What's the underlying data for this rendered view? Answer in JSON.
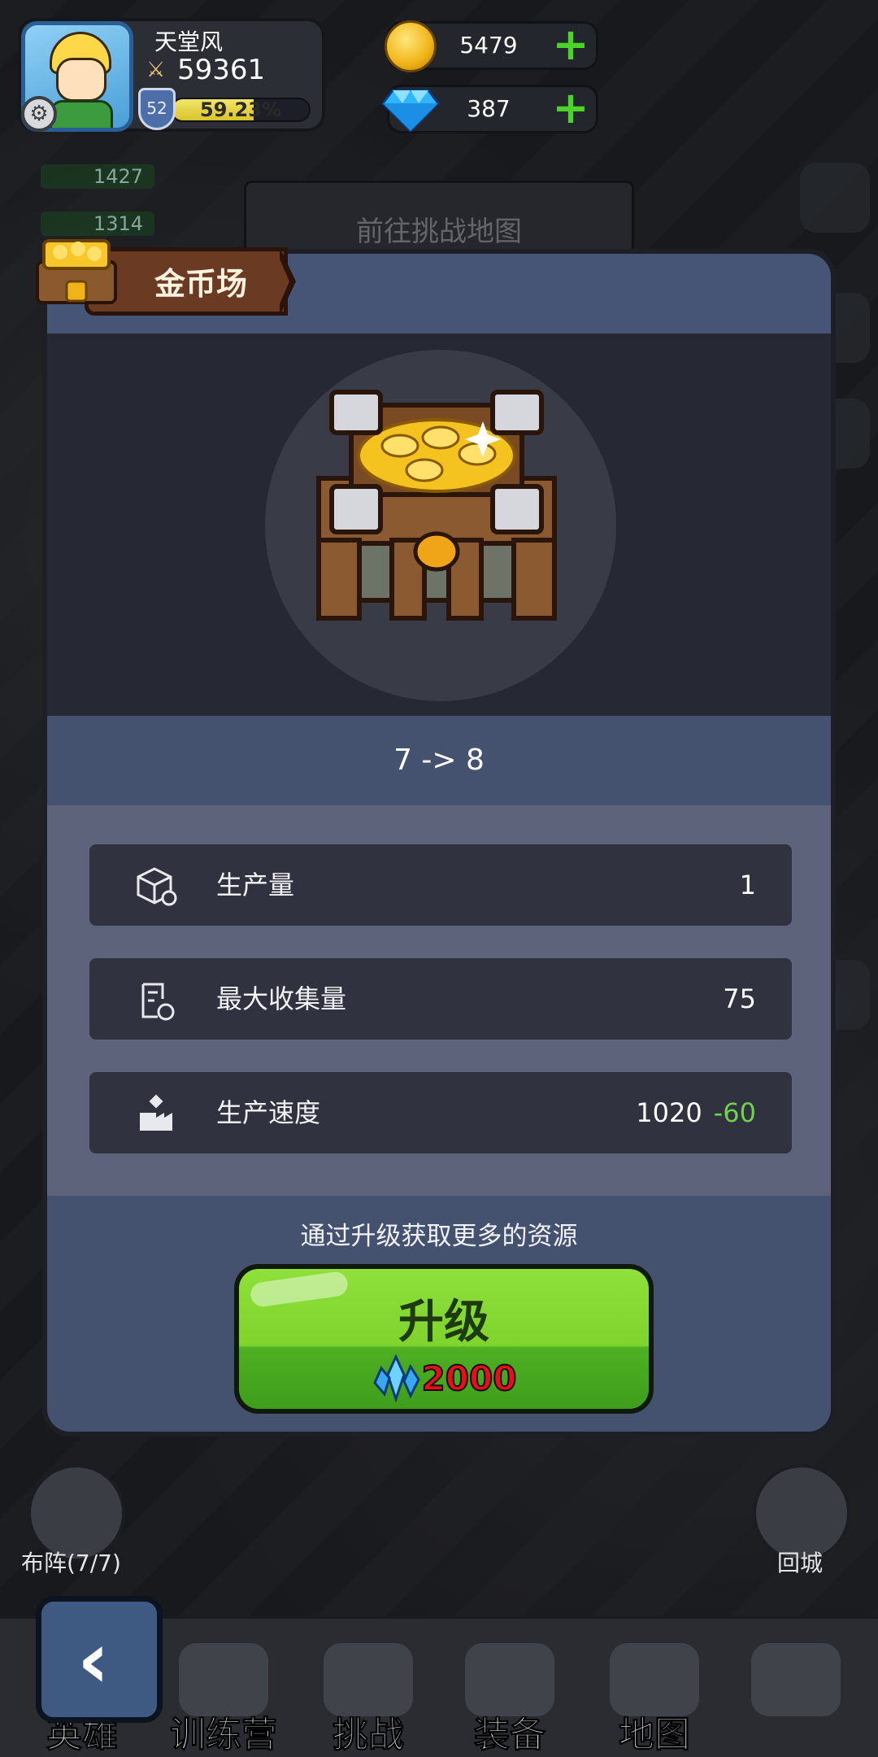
{
  "player": {
    "name": "天堂风",
    "power": "59361",
    "level": "52",
    "xp_percent": "59.23%",
    "xp_fraction": 0.5923
  },
  "resources": {
    "gold": "5479",
    "diamonds": "387"
  },
  "background": {
    "stat_a": "1427",
    "stat_b": "1314",
    "quest_hint": "前往挑战地图"
  },
  "modal": {
    "title": "金币场",
    "level_change": "7 -> 8",
    "stats": [
      {
        "label": "生产量",
        "value": "1",
        "delta": ""
      },
      {
        "label": "最大收集量",
        "value": "75",
        "delta": ""
      },
      {
        "label": "生产速度",
        "value": "1020",
        "delta": "-60"
      }
    ],
    "hint": "通过升级获取更多的资源",
    "upgrade_label": "升级",
    "upgrade_cost": "2000"
  },
  "bottom": {
    "formation_label": "布阵(7/7)",
    "return_label": "回城",
    "nav": [
      {
        "label": "英雄"
      },
      {
        "label": "训练营"
      },
      {
        "label": "挑战"
      },
      {
        "label": "装备"
      },
      {
        "label": "地图"
      },
      {
        "label": ""
      }
    ]
  },
  "colors": {
    "positive_delta": "#6fd24a",
    "cost_red": "#e4111b",
    "button_green": "#7ed32c"
  }
}
